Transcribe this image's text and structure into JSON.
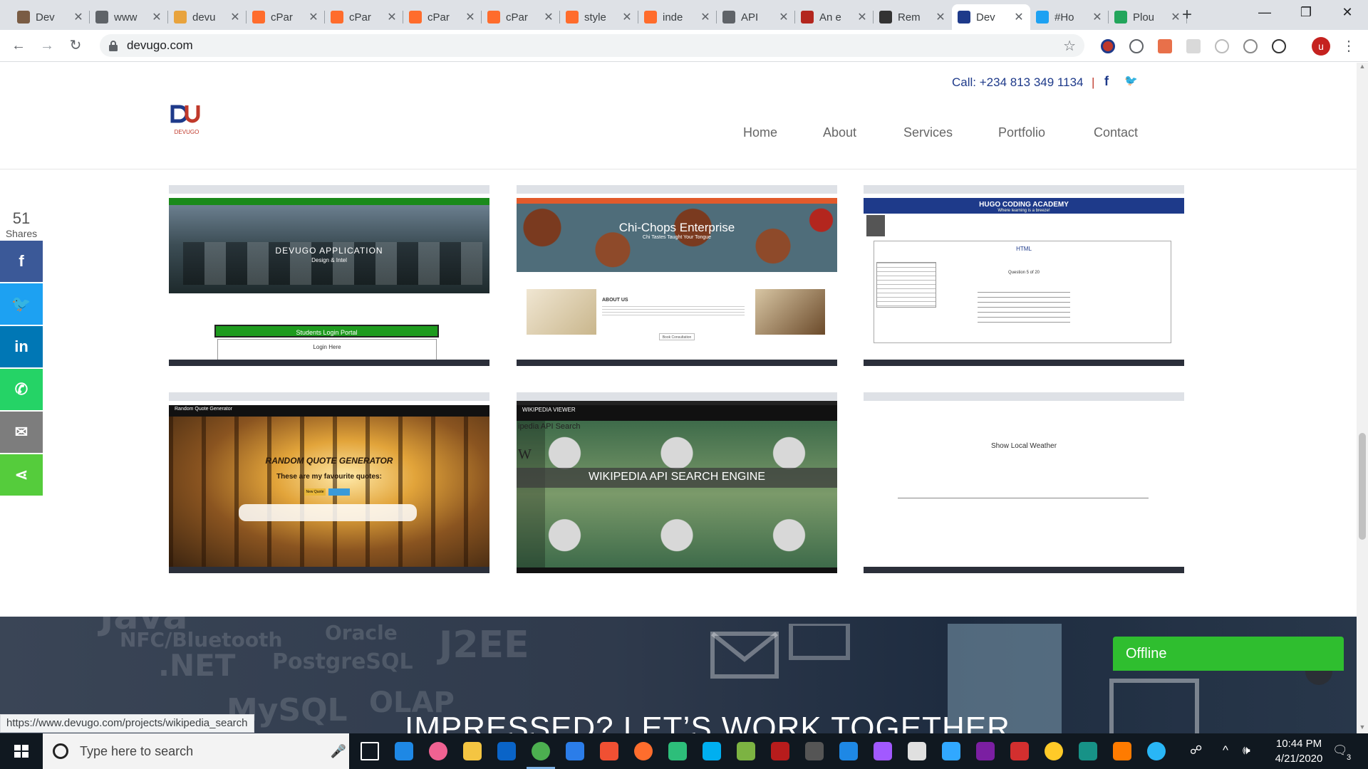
{
  "browser": {
    "tabs": [
      {
        "title": "Dev",
        "color": "#7a5c44"
      },
      {
        "title": "www",
        "color": "#5f6368"
      },
      {
        "title": "devu",
        "color": "#e8a33d"
      },
      {
        "title": "cPar",
        "color": "#ff6c2c"
      },
      {
        "title": "cPar",
        "color": "#ff6c2c"
      },
      {
        "title": "cPar",
        "color": "#ff6c2c"
      },
      {
        "title": "cPar",
        "color": "#ff6c2c"
      },
      {
        "title": "style",
        "color": "#ff6c2c"
      },
      {
        "title": "inde",
        "color": "#ff6c2c"
      },
      {
        "title": "API",
        "color": "#5f6368"
      },
      {
        "title": "An e",
        "color": "#b3261e"
      },
      {
        "title": "Rem",
        "color": "#333333"
      },
      {
        "title": "Dev",
        "color": "#1e3a8a"
      },
      {
        "title": "#Ho",
        "color": "#1da1f2"
      },
      {
        "title": "Plou",
        "color": "#22a55b"
      }
    ],
    "active_tab_index": 12,
    "new_tab_label": "+",
    "window_controls": {
      "minimize": "—",
      "maximize": "❐",
      "close": "✕"
    },
    "nav": {
      "back": "←",
      "forward": "→",
      "reload": "↻"
    },
    "address": "devugo.com",
    "bookmark_icon": "☆",
    "profile_initial": "u",
    "menu": "⋮",
    "status_url": "https://www.devugo.com/projects/wikipedia_search"
  },
  "site": {
    "call_text": "Call: +234 813 349 1134",
    "divider": "|",
    "social_top": [
      "f",
      "🐦"
    ],
    "logo_text": "DEVUGO",
    "nav": [
      "Home",
      "About",
      "Services",
      "Portfolio",
      "Contact"
    ],
    "share": {
      "count": "51",
      "label": "Shares",
      "buttons": [
        {
          "name": "facebook",
          "glyph": "f",
          "color": "#3b5998"
        },
        {
          "name": "twitter",
          "glyph": "🐦",
          "color": "#1da1f2"
        },
        {
          "name": "linkedin",
          "glyph": "in",
          "color": "#0077b5"
        },
        {
          "name": "whatsapp",
          "glyph": "✆",
          "color": "#25d366"
        },
        {
          "name": "email",
          "glyph": "✉",
          "color": "#7d7d7d"
        },
        {
          "name": "sharethis",
          "glyph": "⋖",
          "color": "#55cc3c"
        }
      ]
    },
    "portfolio": [
      {
        "caption": "DEVUGO APPLICATION",
        "sub": "Design & Intel",
        "extra": "Students Login Portal",
        "extra2": "Login Here"
      },
      {
        "caption": "Chi-Chops Enterprise",
        "sub": "Chi Tastes Taught Your Tongue",
        "extra": "ABOUT US",
        "extra2": "Book Consultation"
      },
      {
        "caption": "HUGO CODING ACADEMY",
        "sub": "Where learning is a breeze!",
        "extra": "HTML",
        "extra2": "Question 5 of 20"
      },
      {
        "caption": "RANDOM QUOTE GENERATOR",
        "sub": "These are my favourite quotes:",
        "extra": "Random Quote Generator",
        "extra2": "New Quote"
      },
      {
        "caption": "WIKIPEDIA API SEARCH ENGINE",
        "sub": "WIKIPEDIA VIEWER",
        "extra": "ipedia API Search",
        "extra2": "W"
      },
      {
        "caption": "Show Local Weather",
        "sub": "",
        "extra": "",
        "extra2": ""
      }
    ],
    "cta": {
      "headline": "IMPRESSED? LET’S WORK TOGETHER",
      "bg_words": [
        "NFC/Bluetooth",
        ".NET",
        "PostgreSQL",
        "MySQL",
        "OLAP",
        "Oracle",
        "J2EE",
        "Java"
      ]
    },
    "to_top": "⌃",
    "offline": "Offline"
  },
  "taskbar": {
    "search_placeholder": "Type here to search",
    "time": "10:44 PM",
    "date": "4/21/2020",
    "notif_count": "3",
    "apps": [
      "task-view",
      "edge",
      "itunes",
      "file-explorer",
      "mail",
      "chrome",
      "vscode",
      "git",
      "swift",
      "sourcetree",
      "skype",
      "network",
      "filezilla",
      "wamp",
      "teamviewer",
      "figma",
      "paint",
      "photoshop",
      "dev-app",
      "app",
      "hs",
      "gitkraken",
      "vlc",
      "help"
    ]
  }
}
